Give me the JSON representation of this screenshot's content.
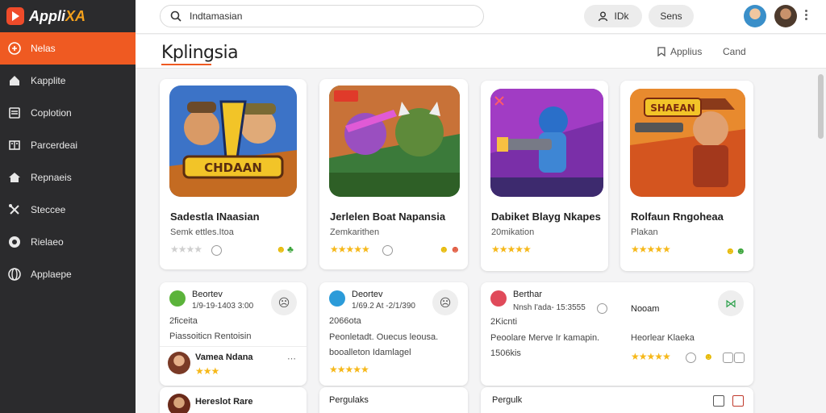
{
  "app": {
    "logo_text": "Appli",
    "logo_accent": "XA"
  },
  "sidebar": {
    "items": [
      {
        "label": "Nelas",
        "icon": "gamepad-icon",
        "active": true
      },
      {
        "label": "Kapplite",
        "icon": "home-icon"
      },
      {
        "label": "Coplotion",
        "icon": "list-icon"
      },
      {
        "label": "Parcerdeai",
        "icon": "book-icon"
      },
      {
        "label": "Repnaeis",
        "icon": "house-icon"
      },
      {
        "label": "Steccee",
        "icon": "tools-icon"
      },
      {
        "label": "Rielaeo",
        "icon": "settings-icon"
      },
      {
        "label": "Applaepe",
        "icon": "globe-icon"
      }
    ]
  },
  "header": {
    "search_value": "Indtamasian",
    "pill1_label": "IDk",
    "pill2_label": "Sens"
  },
  "subheader": {
    "title": "Kplingsia",
    "link1": "Applius",
    "link2": "Cand"
  },
  "games": [
    {
      "title": "Sadestla  INaasian",
      "subtitle": "Semk ettles.Itoa",
      "rating": 0,
      "banner": "CHDAAN"
    },
    {
      "title": "Jerlelen Boat Napansia",
      "subtitle": "Zemkarithen",
      "rating": 5,
      "banner": ""
    },
    {
      "title": "Dabiket Blayg Nkapes",
      "subtitle": "20mikation",
      "rating": 5,
      "banner": ""
    },
    {
      "title": "Rolfaun Rngoheaa",
      "subtitle": "Plakan",
      "rating": 5,
      "banner": "SHAEAN"
    }
  ],
  "reviews": [
    {
      "name": "Beortev",
      "meta": "1/9-19-1403 3:00",
      "line1": "2ficeita",
      "line2": "Piassoiticn  Rentoisin",
      "extra": {
        "name": "Vamea  Ndana",
        "rating": 3
      },
      "footer": "Hereslot  Rare"
    },
    {
      "name": "Deortev",
      "meta": "1/69.2 At -2/1/390",
      "line1": "2066ota",
      "line2": "Peonletadt.  Ouecus  leousa.",
      "line3": "booalleton  Idamlagel",
      "rating": 5,
      "footer": "Pergulaks"
    },
    {
      "name": "Berthar",
      "meta": "Nnsh  I'ada- 15:3555",
      "line1": "2Kicnti",
      "line2": "Peoolare  Merve  Ir  kamapin.",
      "line3": "1506kis",
      "side_label": "Nooam",
      "side_text": "Heorlear  Klaeka",
      "rating": 5,
      "footer": "Pergulk"
    }
  ]
}
